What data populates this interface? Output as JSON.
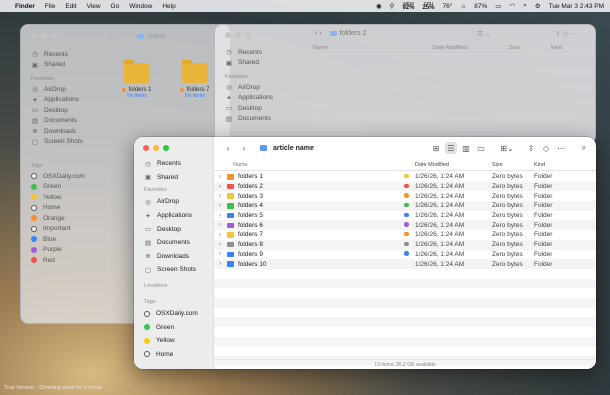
{
  "menubar": {
    "items": [
      "Finder",
      "File",
      "Edit",
      "View",
      "Go",
      "Window",
      "Help"
    ],
    "status": {
      "mem_label": "MEM",
      "mem_value": "92%",
      "cpu_label": "CPU",
      "cpu_value": "25%",
      "temp": "76°",
      "battery": "87%",
      "datetime": "Tue Mar 3  2:43 PM"
    }
  },
  "bgwindow1": {
    "title": "Yellow",
    "sidebar": {
      "favorites": [
        "Recents",
        "Shared"
      ],
      "favorites2_header": "Favorites",
      "favorites2": [
        "AirDrop",
        "Applications",
        "Desktop",
        "Documents",
        "Downloads",
        "Screen Shots"
      ],
      "tags_header": "Tags",
      "tags": [
        {
          "label": "OSXDaily.com",
          "color": "#ffffff"
        },
        {
          "label": "Green",
          "color": "#3fbf4a"
        },
        {
          "label": "Yellow",
          "color": "#f3c531"
        },
        {
          "label": "Home",
          "color": "#ffffff"
        },
        {
          "label": "Orange",
          "color": "#f5922a"
        },
        {
          "label": "Important",
          "color": "#ffffff"
        },
        {
          "label": "Blue",
          "color": "#3a82f7"
        },
        {
          "label": "Purple",
          "color": "#a45cd6"
        },
        {
          "label": "Red",
          "color": "#f0524b"
        }
      ]
    },
    "folders": [
      {
        "name": "folders 1",
        "subtitle": "No items",
        "dot": "#f5922a"
      },
      {
        "name": "folders 7",
        "subtitle": "No items",
        "dot": "#f5922a"
      }
    ]
  },
  "bgwindow2": {
    "title": "folders 2",
    "sidebar": [
      "Recents",
      "Shared"
    ],
    "favorites_header": "Favorites",
    "favorites": [
      "AirDrop",
      "Applications",
      "Desktop",
      "Documents"
    ],
    "columns": [
      "Name",
      "Date Modified",
      "Size",
      "Kind"
    ]
  },
  "main": {
    "title": "article name",
    "sidebar": {
      "top": [
        "Recents",
        "Shared"
      ],
      "favorites_header": "Favorites",
      "favorites": [
        "AirDrop",
        "Applications",
        "Desktop",
        "Documents",
        "Downloads",
        "Screen Shots"
      ],
      "locations_header": "Locations",
      "tags_header": "Tags",
      "tags": [
        {
          "label": "OSXDaily.com",
          "color": "#ffffff"
        },
        {
          "label": "Green",
          "color": "#34c759"
        },
        {
          "label": "Yellow",
          "color": "#ffcc00"
        },
        {
          "label": "Home",
          "color": "#ffffff"
        }
      ]
    },
    "columns": {
      "name": "Name",
      "date": "Date Modified",
      "size": "Size",
      "kind": "Kind"
    },
    "rows": [
      {
        "name": "folders 1",
        "folder_color": "#f5922a",
        "tag_color": "#f3c531",
        "date": "1/26/26, 1:24 AM",
        "size": "Zero bytes",
        "kind": "Folder"
      },
      {
        "name": "folders 2",
        "folder_color": "#f0524b",
        "tag_color": "#f0524b",
        "date": "1/26/26, 1:24 AM",
        "size": "Zero bytes",
        "kind": "Folder"
      },
      {
        "name": "folders 3",
        "folder_color": "#f3c531",
        "tag_color": "#f5922a",
        "date": "1/26/26, 1:24 AM",
        "size": "Zero bytes",
        "kind": "Folder"
      },
      {
        "name": "folders 4",
        "folder_color": "#3fbf4a",
        "tag_color": "#3fbf4a",
        "date": "1/26/26, 1:24 AM",
        "size": "Zero bytes",
        "kind": "Folder"
      },
      {
        "name": "folders 5",
        "folder_color": "#3a82f7",
        "tag_color": "#3a82f7",
        "date": "1/26/26, 1:24 AM",
        "size": "Zero bytes",
        "kind": "Folder"
      },
      {
        "name": "folders 6",
        "folder_color": "#a45cd6",
        "tag_color": "#a45cd6",
        "date": "1/26/26, 1:24 AM",
        "size": "Zero bytes",
        "kind": "Folder"
      },
      {
        "name": "folders 7",
        "folder_color": "#f3c531",
        "tag_color": "#f5922a",
        "date": "1/26/26, 1:24 AM",
        "size": "Zero bytes",
        "kind": "Folder"
      },
      {
        "name": "folders 8",
        "folder_color": "#8e8e93",
        "tag_color": "#8e8e93",
        "date": "1/26/26, 1:24 AM",
        "size": "Zero bytes",
        "kind": "Folder"
      },
      {
        "name": "folders 9",
        "folder_color": "#3a82f7",
        "tag_color": "#3a82f7",
        "date": "1/26/26, 1:24 AM",
        "size": "Zero bytes",
        "kind": "Folder"
      },
      {
        "name": "folders 10",
        "folder_color": "#3a82f7",
        "tag_color": "",
        "date": "1/26/26, 1:24 AM",
        "size": "Zero bytes",
        "kind": "Folder"
      }
    ],
    "status": "13 items, 95.2 GB available"
  },
  "trial_text": "Trial Version - Dimming used for 3 hours"
}
